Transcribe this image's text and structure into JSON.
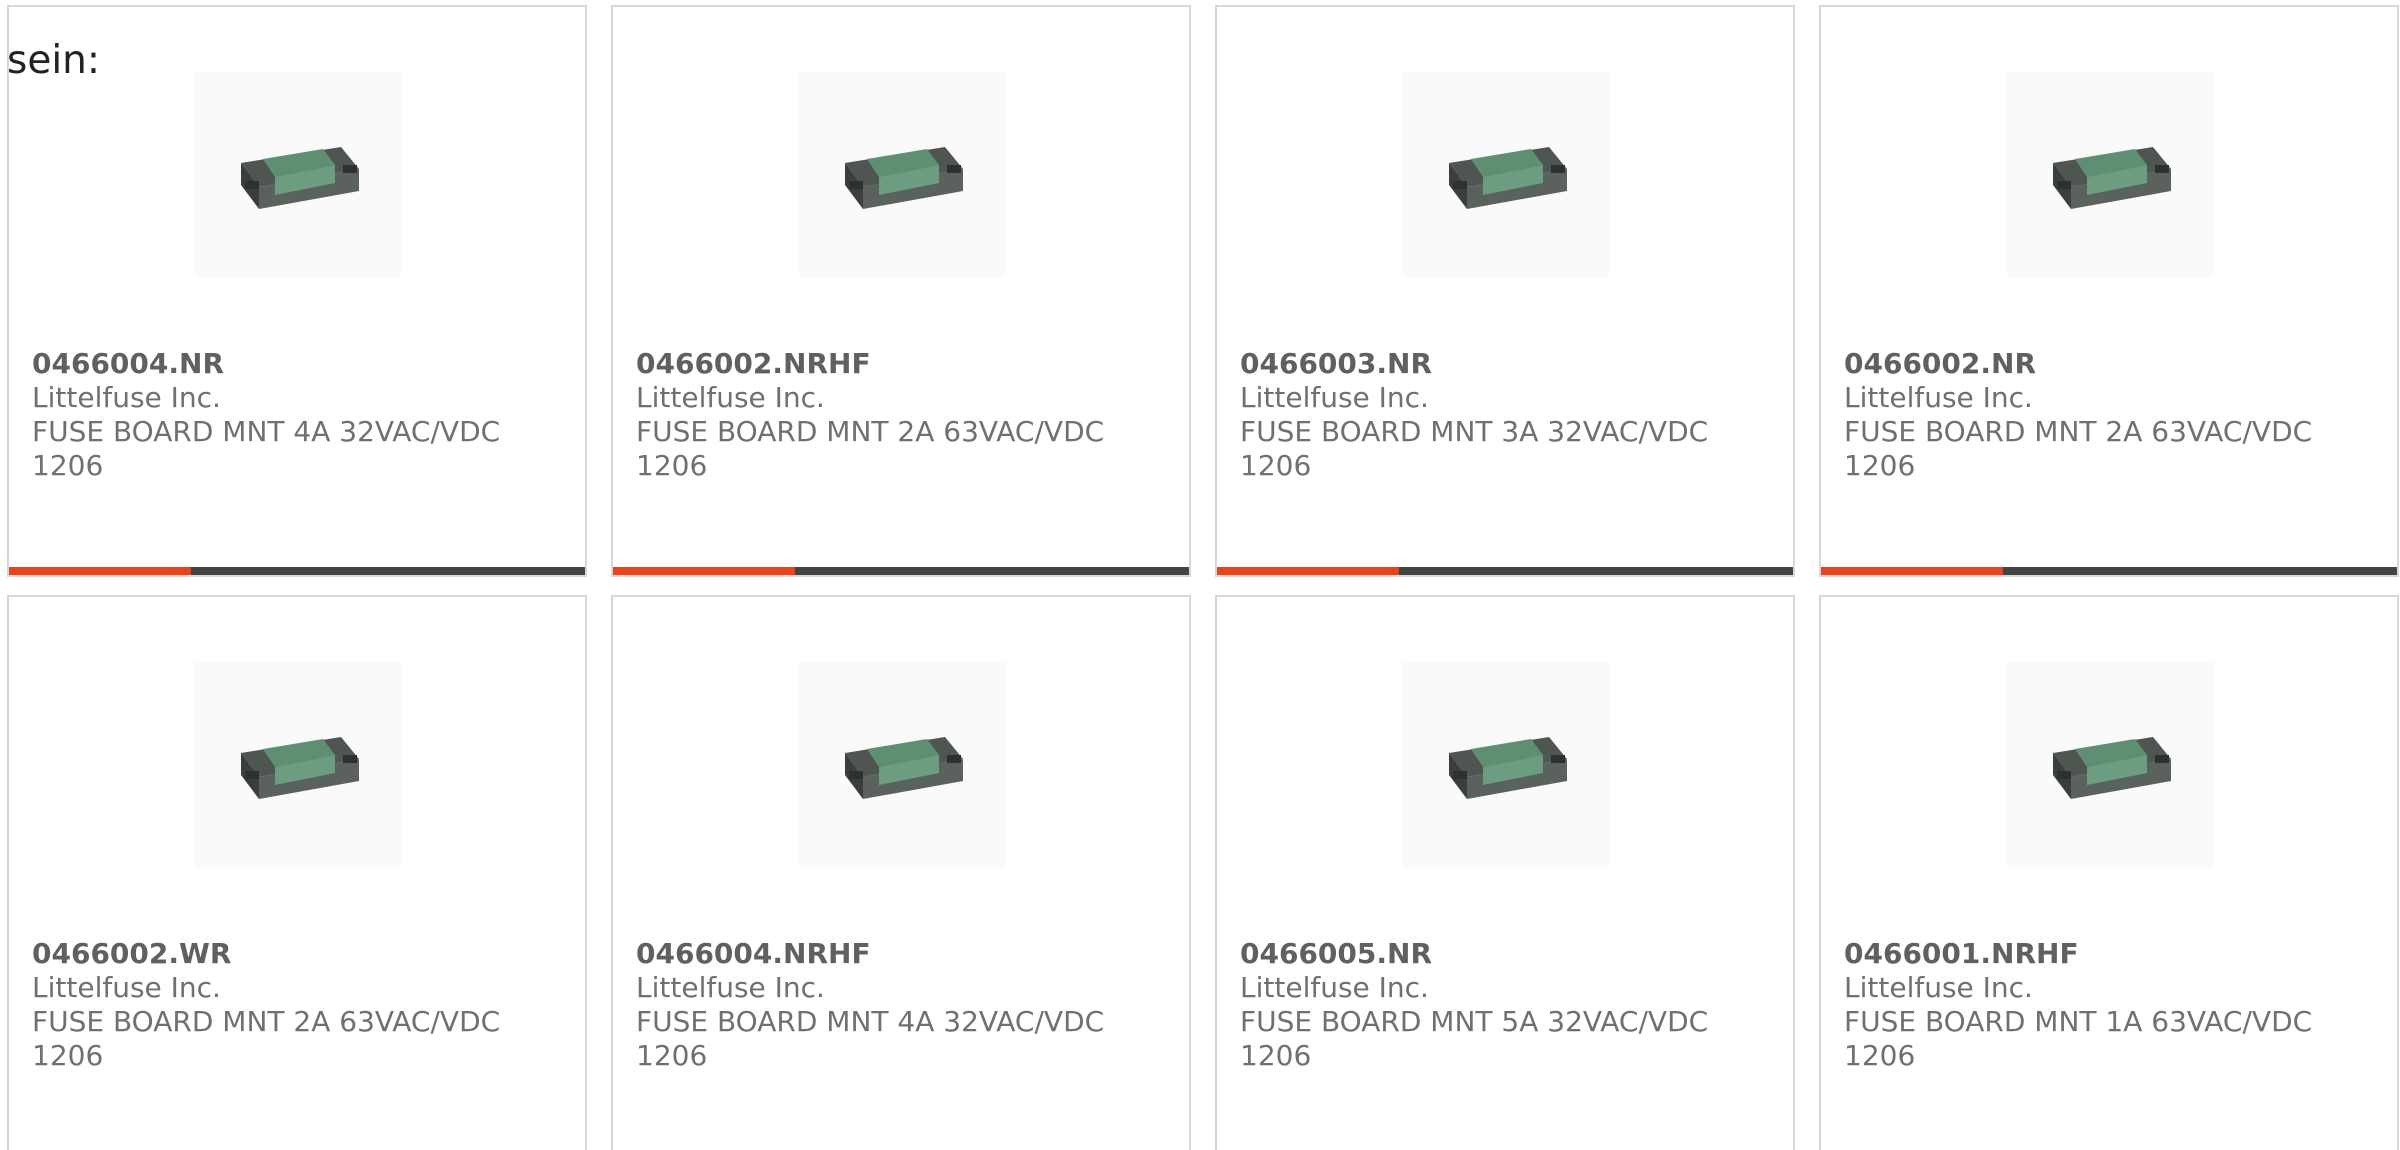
{
  "intro": {
    "text": "sein:"
  },
  "colors": {
    "accent": "#e8441c",
    "bar": "#444444",
    "border": "#d8d8d8"
  },
  "products": [
    {
      "part": "0466004.NR",
      "manufacturer": "Littelfuse Inc.",
      "description": "FUSE BOARD MNT 4A 32VAC/VDC 1206",
      "image_icon": "smd-fuse-icon",
      "show_bar": true
    },
    {
      "part": "0466002.NRHF",
      "manufacturer": "Littelfuse Inc.",
      "description": "FUSE BOARD MNT 2A 63VAC/VDC 1206",
      "image_icon": "smd-fuse-icon",
      "show_bar": true
    },
    {
      "part": "0466003.NR",
      "manufacturer": "Littelfuse Inc.",
      "description": "FUSE BOARD MNT 3A 32VAC/VDC 1206",
      "image_icon": "smd-fuse-icon",
      "show_bar": true
    },
    {
      "part": "0466002.NR",
      "manufacturer": "Littelfuse Inc.",
      "description": "FUSE BOARD MNT 2A 63VAC/VDC 1206",
      "image_icon": "smd-fuse-icon",
      "show_bar": true
    },
    {
      "part": "0466002.WR",
      "manufacturer": "Littelfuse Inc.",
      "description": "FUSE BOARD MNT 2A 63VAC/VDC 1206",
      "image_icon": "smd-fuse-icon",
      "show_bar": false
    },
    {
      "part": "0466004.NRHF",
      "manufacturer": "Littelfuse Inc.",
      "description": "FUSE BOARD MNT 4A 32VAC/VDC 1206",
      "image_icon": "smd-fuse-icon",
      "show_bar": false
    },
    {
      "part": "0466005.NR",
      "manufacturer": "Littelfuse Inc.",
      "description": "FUSE BOARD MNT 5A 32VAC/VDC 1206",
      "image_icon": "smd-fuse-icon",
      "show_bar": false
    },
    {
      "part": "0466001.NRHF",
      "manufacturer": "Littelfuse Inc.",
      "description": "FUSE BOARD MNT 1A 63VAC/VDC 1206",
      "image_icon": "smd-fuse-icon",
      "show_bar": false
    }
  ]
}
